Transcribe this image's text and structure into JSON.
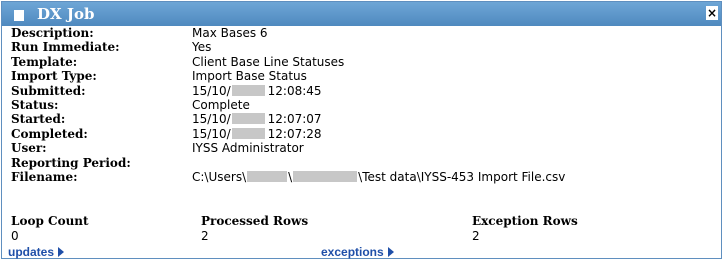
{
  "dialog": {
    "title": "DX Job",
    "close_label": "×"
  },
  "fields": [
    {
      "label": "Description:",
      "value": "Max Bases 6"
    },
    {
      "label": "Run Immediate:",
      "value": "Yes"
    },
    {
      "label": "Template:",
      "value": "Client Base Line Statuses"
    },
    {
      "label": "Import Type:",
      "value": "Import Base Status"
    },
    {
      "label": "Submitted:",
      "value_pre": "15/10/",
      "value_post": "12:08:45"
    },
    {
      "label": "Status:",
      "value": "Complete"
    },
    {
      "label": "Started:",
      "value_pre": "15/10/",
      "value_post": "12:07:07"
    },
    {
      "label": "Completed:",
      "value_pre": "15/10/",
      "value_post": "12:07:28"
    },
    {
      "label": "User:",
      "value": "IYSS Administrator"
    },
    {
      "label": "Reporting Period:",
      "value": ""
    },
    {
      "label": "Filename:",
      "value_pre": "C:\\Users\\",
      "value_sep": "\\",
      "value_post": "\\Test data\\IYSS-453 Import File.csv"
    }
  ],
  "counts": {
    "loop_count_label": "Loop Count",
    "loop_count_value": "0",
    "processed_rows_label": "Processed Rows",
    "processed_rows_value": "2",
    "exception_rows_label": "Exception Rows",
    "exception_rows_value": "2"
  },
  "links": {
    "updates": "updates",
    "exceptions": "exceptions"
  },
  "colors": {
    "titlebar": "#5b94c8",
    "link": "#1f4fa8",
    "redaction": "#c7c7c7"
  }
}
